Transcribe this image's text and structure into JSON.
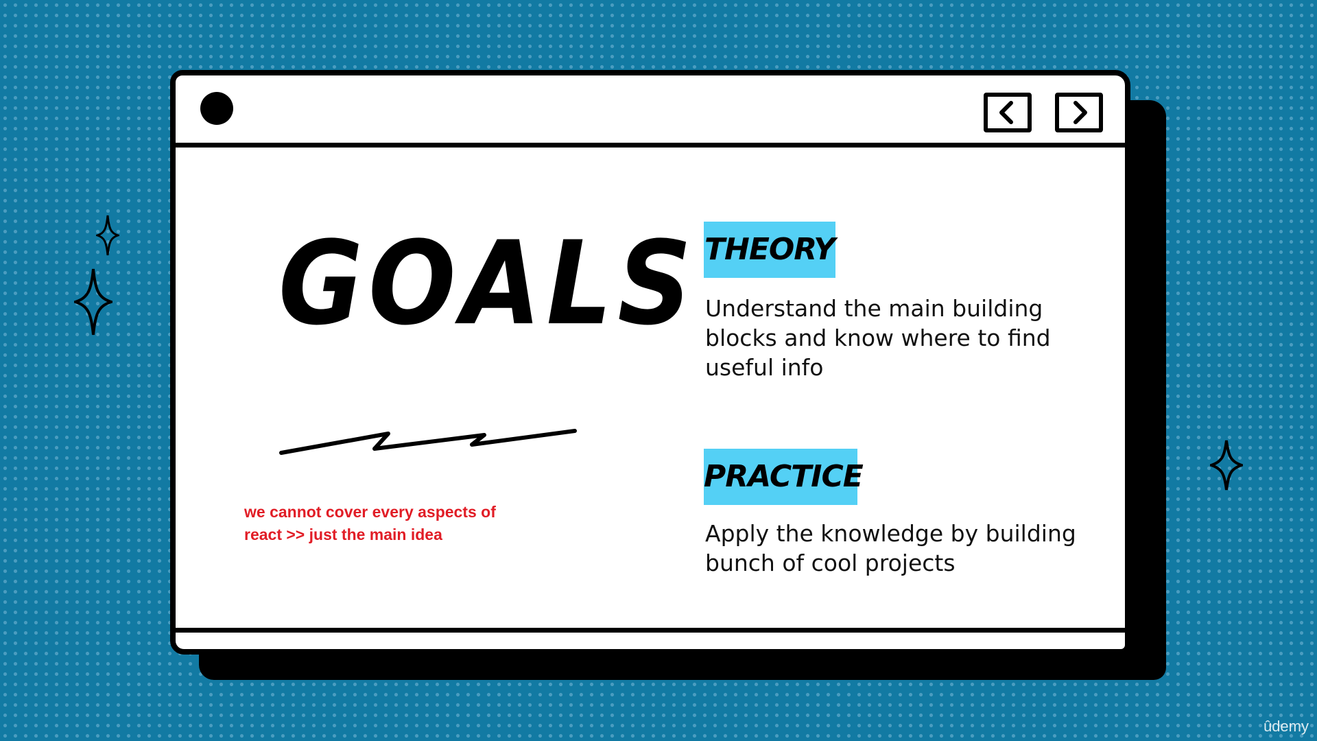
{
  "slide": {
    "title": "GOALS",
    "note": "we cannot cover every aspects of react >> just the main idea",
    "sections": [
      {
        "tag": "THEORY",
        "text": "Understand the main building blocks and know where to find useful info"
      },
      {
        "tag": "PRACTICE",
        "text": "Apply the knowledge by building bunch of cool projects"
      }
    ]
  },
  "watermark": "ûdemy",
  "icons": {
    "prev": "chevron-left-icon",
    "next": "chevron-right-icon",
    "window_dot": "circle-dot-icon",
    "sparkle": "sparkle-icon"
  },
  "colors": {
    "background": "#127aa3",
    "tag_fill": "#54d0f5",
    "note_text": "#e11d26"
  }
}
